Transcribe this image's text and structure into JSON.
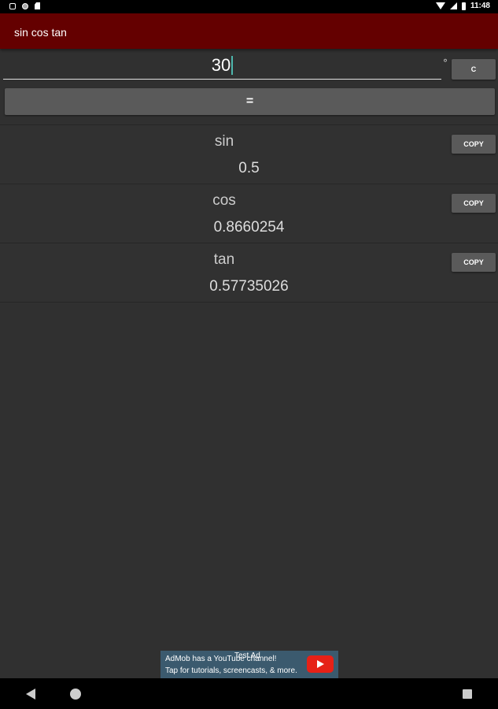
{
  "status_bar": {
    "time": "11:48"
  },
  "app_bar": {
    "title": "sin cos tan"
  },
  "input": {
    "value": "30",
    "unit": "°",
    "clear_label": "C"
  },
  "equals_label": "=",
  "results": [
    {
      "name": "sin",
      "value": "0.5",
      "copy_label": "COPY"
    },
    {
      "name": "cos",
      "value": "0.8660254",
      "copy_label": "COPY"
    },
    {
      "name": "tan",
      "value": "0.57735026",
      "copy_label": "COPY"
    }
  ],
  "ad": {
    "label": "Test Ad",
    "line1": "AdMob has a YouTube channel!",
    "line2": "Tap for tutorials, screencasts, & more."
  },
  "colors": {
    "app_bar": "#640000",
    "background": "#303030",
    "button": "#5a5a5a"
  }
}
